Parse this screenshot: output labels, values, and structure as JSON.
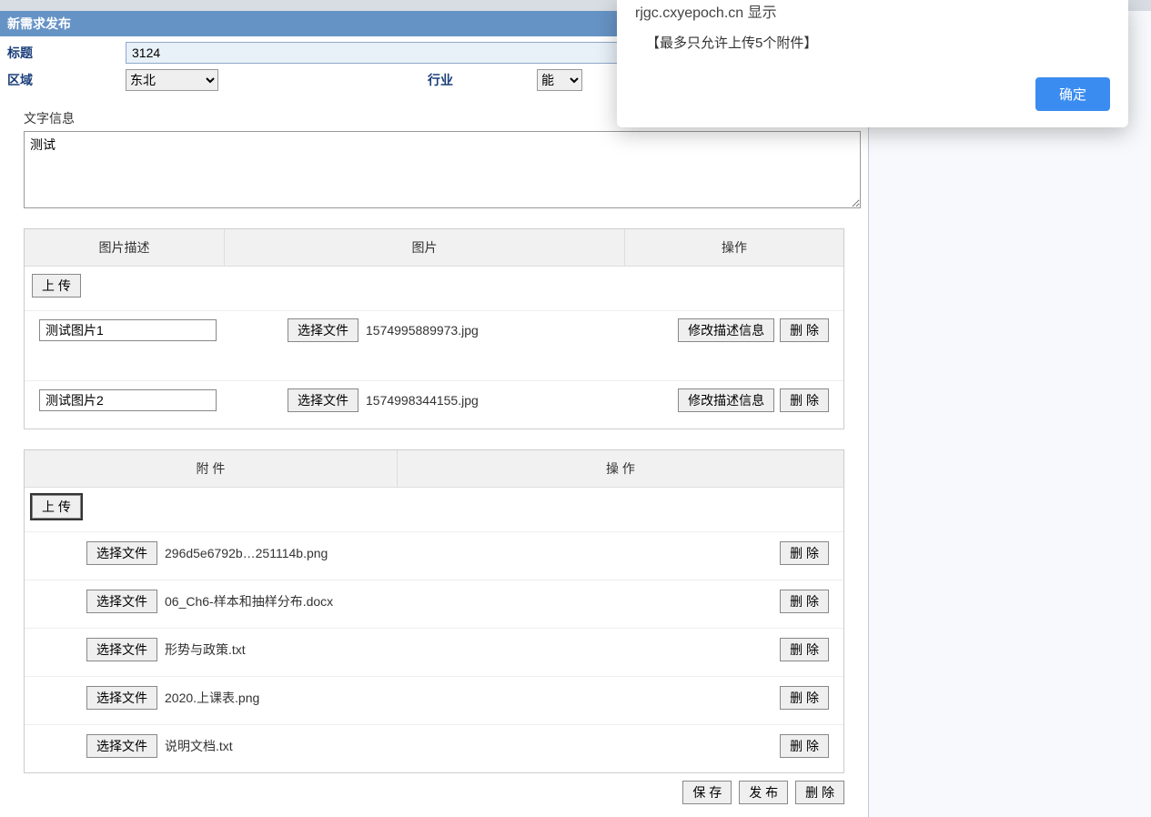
{
  "panel": {
    "title": "新需求发布"
  },
  "form": {
    "title_label": "标题",
    "title_value": "3124",
    "region_label": "区域",
    "region_value": "东北",
    "industry_label": "行业",
    "industry_value": "能"
  },
  "text_info": {
    "label": "文字信息",
    "value": "测试"
  },
  "images": {
    "headers": {
      "desc": "图片描述",
      "img": "图片",
      "act": "操作"
    },
    "upload_label": "上 传",
    "choose_label": "选择文件",
    "edit_label": "修改描述信息",
    "delete_label": "删 除",
    "rows": [
      {
        "desc": "测试图片1",
        "file": "1574995889973.jpg"
      },
      {
        "desc": "测试图片2",
        "file": "1574998344155.jpg"
      }
    ]
  },
  "attachments": {
    "headers": {
      "att": "附 件",
      "act": "操 作"
    },
    "upload_label": "上 传",
    "choose_label": "选择文件",
    "delete_label": "删 除",
    "rows": [
      {
        "file": "296d5e6792b…251114b.png"
      },
      {
        "file": "06_Ch6-样本和抽样分布.docx"
      },
      {
        "file": "形势与政策.txt"
      },
      {
        "file": "2020.上课表.png"
      },
      {
        "file": "说明文档.txt"
      }
    ]
  },
  "footer": {
    "save": "保 存",
    "publish": "发 布",
    "delete": "删 除"
  },
  "alert": {
    "title": "rjgc.cxyepoch.cn 显示",
    "message": "【最多只允许上传5个附件】",
    "ok": "确定"
  }
}
